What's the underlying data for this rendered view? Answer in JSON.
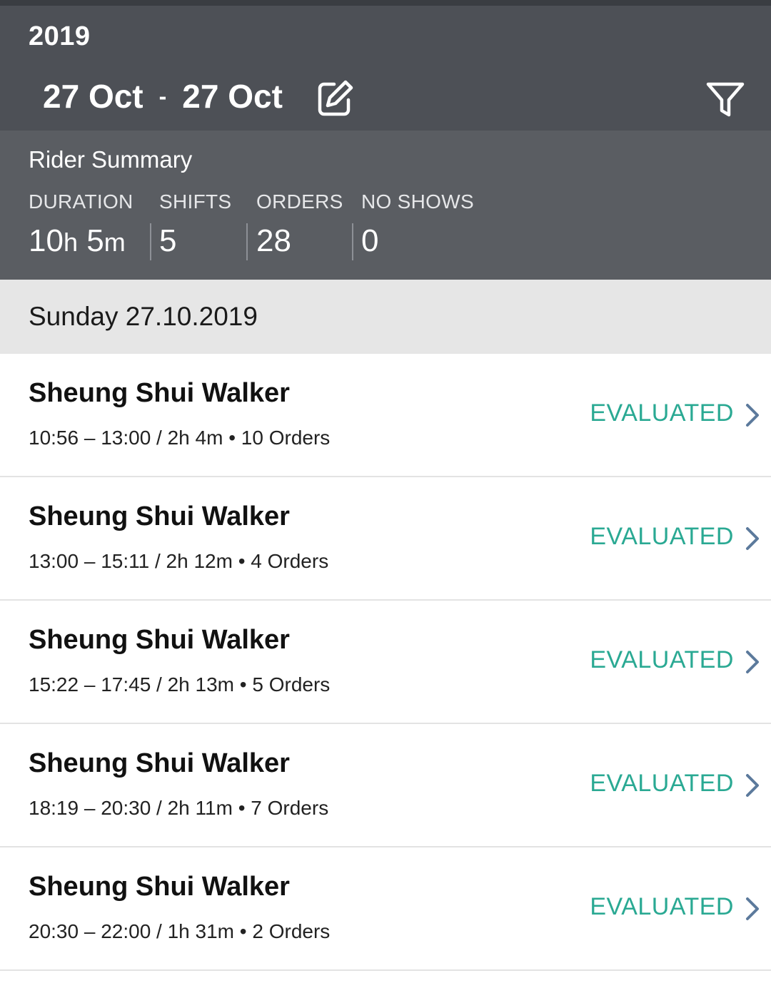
{
  "header": {
    "year": "2019",
    "date_from": "27 Oct",
    "date_separator": "-",
    "date_to": "27 Oct",
    "edit_icon": "edit-icon",
    "filter_icon": "filter-icon"
  },
  "summary": {
    "title": "Rider Summary",
    "duration": {
      "label": "DURATION",
      "hours": "10",
      "hours_unit": "h",
      "minutes": "5",
      "minutes_unit": "m"
    },
    "shifts": {
      "label": "SHIFTS",
      "value": "5"
    },
    "orders": {
      "label": "ORDERS",
      "value": "28"
    },
    "no_shows": {
      "label": "NO SHOWS",
      "value": "0"
    }
  },
  "day": {
    "label": "Sunday 27.10.2019"
  },
  "colors": {
    "header_bg": "#4d5056",
    "summary_bg": "#5a5d62",
    "status_green": "#2aa993",
    "chevron": "#5c7a9c"
  },
  "shifts": [
    {
      "title": "Sheung Shui Walker",
      "meta": "10:56 – 13:00 / 2h 4m • 10 Orders",
      "status": "EVALUATED"
    },
    {
      "title": "Sheung Shui Walker",
      "meta": "13:00 – 15:11 / 2h 12m • 4 Orders",
      "status": "EVALUATED"
    },
    {
      "title": "Sheung Shui Walker",
      "meta": "15:22 – 17:45 / 2h 13m • 5 Orders",
      "status": "EVALUATED"
    },
    {
      "title": "Sheung Shui Walker",
      "meta": "18:19 – 20:30 / 2h 11m • 7 Orders",
      "status": "EVALUATED"
    },
    {
      "title": "Sheung Shui Walker",
      "meta": "20:30 – 22:00 / 1h 31m • 2 Orders",
      "status": "EVALUATED"
    }
  ]
}
